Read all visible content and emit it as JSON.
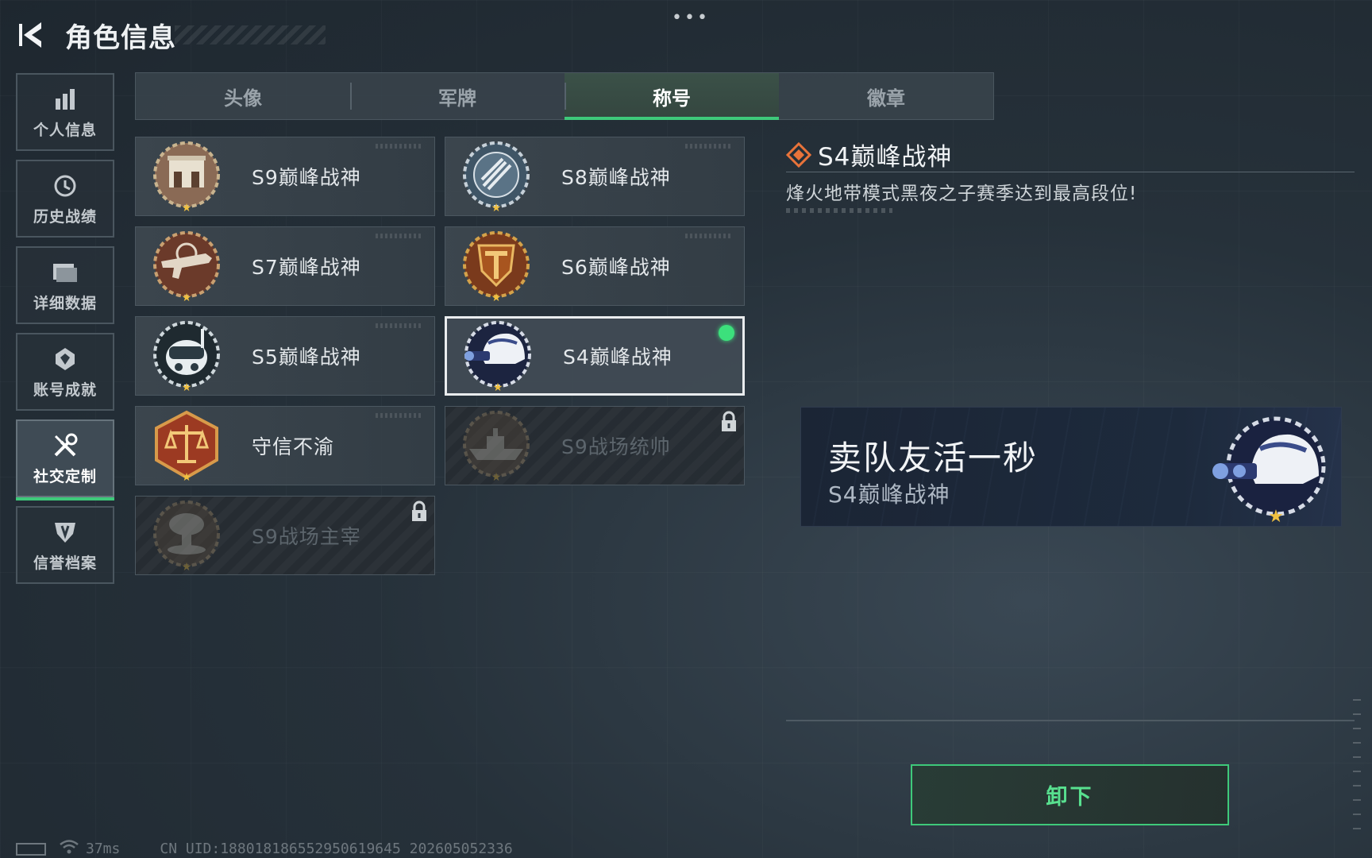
{
  "header": {
    "title": "角色信息",
    "menu_dots": "•••"
  },
  "nav": [
    {
      "label": "个人信息",
      "icon": "bar-chart-icon",
      "active": false
    },
    {
      "label": "历史战绩",
      "icon": "history-clock-icon",
      "active": false
    },
    {
      "label": "详细数据",
      "icon": "folder-icon",
      "active": false
    },
    {
      "label": "账号成就",
      "icon": "achievement-badge-icon",
      "active": false
    },
    {
      "label": "社交定制",
      "icon": "tools-icon",
      "active": true
    },
    {
      "label": "信誉档案",
      "icon": "shield-emblem-icon",
      "active": false
    }
  ],
  "tabs": [
    {
      "label": "头像",
      "active": false
    },
    {
      "label": "军牌",
      "active": false
    },
    {
      "label": "称号",
      "active": true
    },
    {
      "label": "徽章",
      "active": false
    }
  ],
  "titles": [
    {
      "label": "S9巅峰战神",
      "medal": "fortress-medal-icon",
      "locked": false,
      "selected": false
    },
    {
      "label": "S8巅峰战神",
      "medal": "propeller-medal-icon",
      "locked": false,
      "selected": false
    },
    {
      "label": "S7巅峰战神",
      "medal": "rifle-medal-icon",
      "locked": false,
      "selected": false
    },
    {
      "label": "S6巅峰战神",
      "medal": "shield-medal-icon",
      "locked": false,
      "selected": false
    },
    {
      "label": "S5巅峰战神",
      "medal": "diver-mask-medal-icon",
      "locked": false,
      "selected": false
    },
    {
      "label": "S4巅峰战神",
      "medal": "night-vision-helmet-medal-icon",
      "locked": false,
      "selected": true
    },
    {
      "label": "守信不渝",
      "medal": "scales-medal-icon",
      "locked": false,
      "selected": false
    },
    {
      "label": "S9战场统帅",
      "medal": "warship-medal-icon",
      "locked": true,
      "selected": false
    },
    {
      "label": "S9战场主宰",
      "medal": "mushroom-cloud-medal-icon",
      "locked": true,
      "selected": false
    }
  ],
  "detail": {
    "title": "S4巅峰战神",
    "description": "烽火地带模式黑夜之子赛季达到最高段位!"
  },
  "preview": {
    "player_name": "卖队友活一秒",
    "title": "S4巅峰战神"
  },
  "unequip_label": "卸下",
  "footer": {
    "ping": "37ms",
    "uid": "CN UID:188018186552950619645 202605052336"
  },
  "colors": {
    "accent_green": "#3ec97a",
    "equipped_dot": "#3ce07c",
    "diamond_orange": "#e8733a"
  }
}
